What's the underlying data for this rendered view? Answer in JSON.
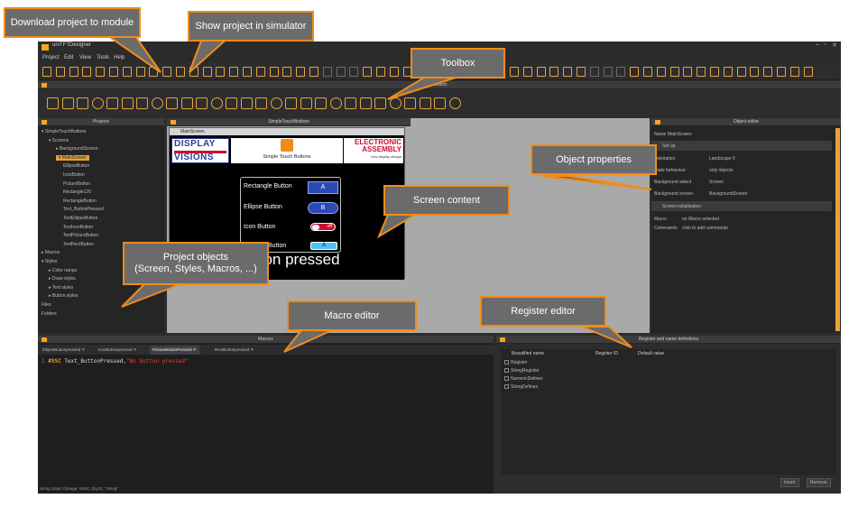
{
  "window": {
    "title": "uniTFTDesigner",
    "controls": [
      "–",
      "▫",
      "✕"
    ]
  },
  "menu": [
    "Project",
    "Edit",
    "View",
    "Tools",
    "Help"
  ],
  "toolbar": {
    "zoom": "60%"
  },
  "toolbox": {
    "title": "Toolbox"
  },
  "projects": {
    "title": "Projects",
    "tree": [
      {
        "label": "SimpleTouchButtons",
        "level": 0,
        "arrow": "▾"
      },
      {
        "label": "Screens",
        "level": 1,
        "arrow": "▾"
      },
      {
        "label": "BackgroundScreen",
        "level": 2,
        "arrow": "▸"
      },
      {
        "label": "MainScreen",
        "level": 2,
        "arrow": "▾",
        "selected": true
      },
      {
        "label": "EllipseButton",
        "level": 3
      },
      {
        "label": "IconButton",
        "level": 3
      },
      {
        "label": "PictureButton",
        "level": 3
      },
      {
        "label": "Rectangle120",
        "level": 3
      },
      {
        "label": "RectangleButton",
        "level": 3
      },
      {
        "label": "Text_ButtonPressed",
        "level": 3
      },
      {
        "label": "TextEllipseButton",
        "level": 3
      },
      {
        "label": "TextIconButton",
        "level": 3
      },
      {
        "label": "TextPictureButton",
        "level": 3
      },
      {
        "label": "TextRectButton",
        "level": 3
      },
      {
        "label": "Macros",
        "level": 0,
        "arrow": "▸"
      },
      {
        "label": "Styles",
        "level": 0,
        "arrow": "▾"
      },
      {
        "label": "Color ramps",
        "level": 1,
        "arrow": "▸"
      },
      {
        "label": "Draw styles",
        "level": 1,
        "arrow": "▸"
      },
      {
        "label": "Text styles",
        "level": 1,
        "arrow": "▸"
      },
      {
        "label": "Button styles",
        "level": 1,
        "arrow": "▸"
      },
      {
        "label": "Files",
        "level": 0
      },
      {
        "label": "Folders",
        "level": 0
      }
    ]
  },
  "designer": {
    "title": "SimpleTouchButtons",
    "screen_title": "MainScreen",
    "logo_left_1": "DISPLAY",
    "logo_left_2": "VISIONS",
    "logo_mid_caption": "Simple Touch Buttons",
    "logo_right_1": "ELECTRONIC",
    "logo_right_2": "ASSEMBLY",
    "logo_right_3": "new display design",
    "buttons": {
      "rect_label": "Rectangle Button",
      "rect_value": "A",
      "ellipse_label": "Ellipse Button",
      "ellipse_value": "B",
      "icon_label": "Icon Button",
      "icon_value": "off",
      "picture_label": "Button"
    },
    "pressed_text": "tton pressed"
  },
  "object_editor": {
    "title": "Object editor",
    "name_label": "Name",
    "name_value": "MainScreen",
    "setup": "Set up",
    "rows": [
      {
        "k": "orientation",
        "v": "Landscape 0"
      },
      {
        "k": "State behaviour",
        "v": "only objects"
      },
      {
        "k": "Background select",
        "v": "Screen"
      },
      {
        "k": "Background screen",
        "v": "BackgroundScreen"
      }
    ],
    "section2": "Screen initialisation",
    "macro_k": "Macro",
    "macro_v": "no Macro selected",
    "commands_k": "Commands",
    "commands_v": "click to add commands"
  },
  "macro_editor": {
    "title": "Macros",
    "tabs": [
      "EllipseButtonpressed",
      "IconButtonpressed",
      "PictureButtonPressed",
      "RectButtonpressed"
    ],
    "line_no": "1",
    "code_kw": "#SSC",
    "code_arg": " Text_ButtonPressed,",
    "code_str": "\"No button pressed\"",
    "status": "String Static Change: #SSC Obj ID, \"String\""
  },
  "register_editor": {
    "title": "Register and name definitions",
    "cols": [
      "Beautified name",
      "Register ID",
      "Default value"
    ],
    "items": [
      "Register",
      "StringRegister",
      "NumericDefines",
      "StringDefines"
    ],
    "insert": "Insert",
    "remove": "Remove"
  },
  "callouts": {
    "download": "Download project to module",
    "simulator": "Show project in simulator",
    "toolbox": "Toolbox",
    "object_properties": "Object properties",
    "screen_content": "Screen content",
    "project_objects": "Project objects\n(Screen, Styles, Macros, ...)",
    "macro_editor": "Macro editor",
    "register_editor": "Register editor"
  },
  "colors": {
    "accent": "#f08c1a",
    "panel": "#252526",
    "callout": "#6b6b6b"
  }
}
